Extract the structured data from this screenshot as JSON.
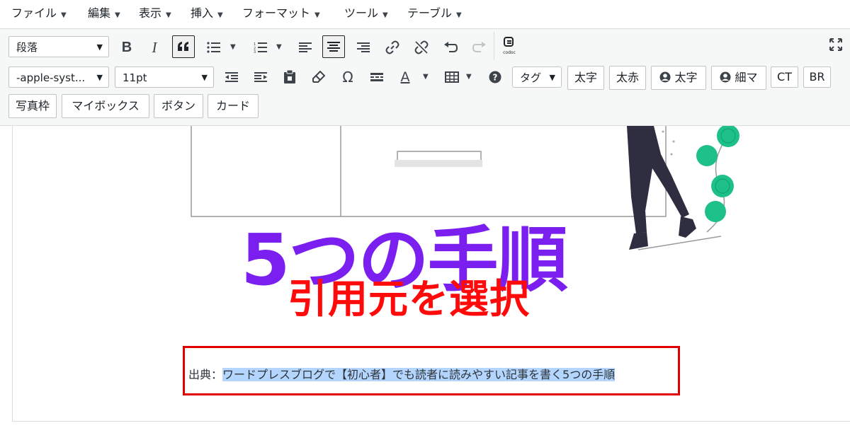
{
  "menu": [
    {
      "label": "ファイル"
    },
    {
      "label": "編集"
    },
    {
      "label": "表示"
    },
    {
      "label": "挿入"
    },
    {
      "label": "フォーマット"
    },
    {
      "label": "ツール"
    },
    {
      "label": "テーブル"
    }
  ],
  "toolbar": {
    "format_select": "段落",
    "font_select": "-apple-syst...",
    "size_select": "11pt",
    "tag_select": "タグ",
    "bold": "B",
    "italic": "I",
    "omega": "Ω",
    "text_color": "A",
    "buttons_row2": [
      "太字",
      "太赤",
      "太字",
      "細マ",
      "CT",
      "BR"
    ],
    "buttons_row3": [
      "写真枠",
      "マイボックス",
      "ボタン",
      "カード"
    ]
  },
  "content": {
    "image_title": "5つの手順",
    "overlay_label": "引用元を選択",
    "caption_prefix": "出典：",
    "caption_link": "ワードプレスブログで【初心者】でも読者に読みやすい記事を書く5つの手順"
  },
  "colors": {
    "title_purple": "#7b1ef0",
    "label_red": "#ff0a0a",
    "highlight": "#b4d5fe",
    "plant_green": "#1ec08a"
  }
}
